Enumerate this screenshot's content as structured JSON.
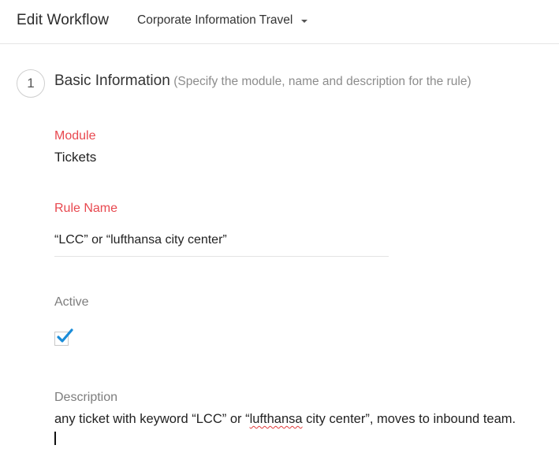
{
  "header": {
    "title": "Edit Workflow",
    "workflow_name": "Corporate Information Travel"
  },
  "section": {
    "step_number": "1",
    "title": "Basic Information",
    "hint": "(Specify the module, name and description for the rule)"
  },
  "module": {
    "label": "Module",
    "value": "Tickets"
  },
  "rule_name": {
    "label": "Rule Name",
    "value": "“LCC” or “lufthansa city center”"
  },
  "active": {
    "label": "Active",
    "checked": true
  },
  "description": {
    "label": "Description",
    "text_before": "any ticket with keyword “LCC” or “",
    "misspelled_word": "lufthansa",
    "text_after": " city center”, moves to inbound team."
  },
  "colors": {
    "required_label": "#e8484f",
    "checkmark": "#1a8cd8",
    "spellcheck": "#e23b3b"
  }
}
